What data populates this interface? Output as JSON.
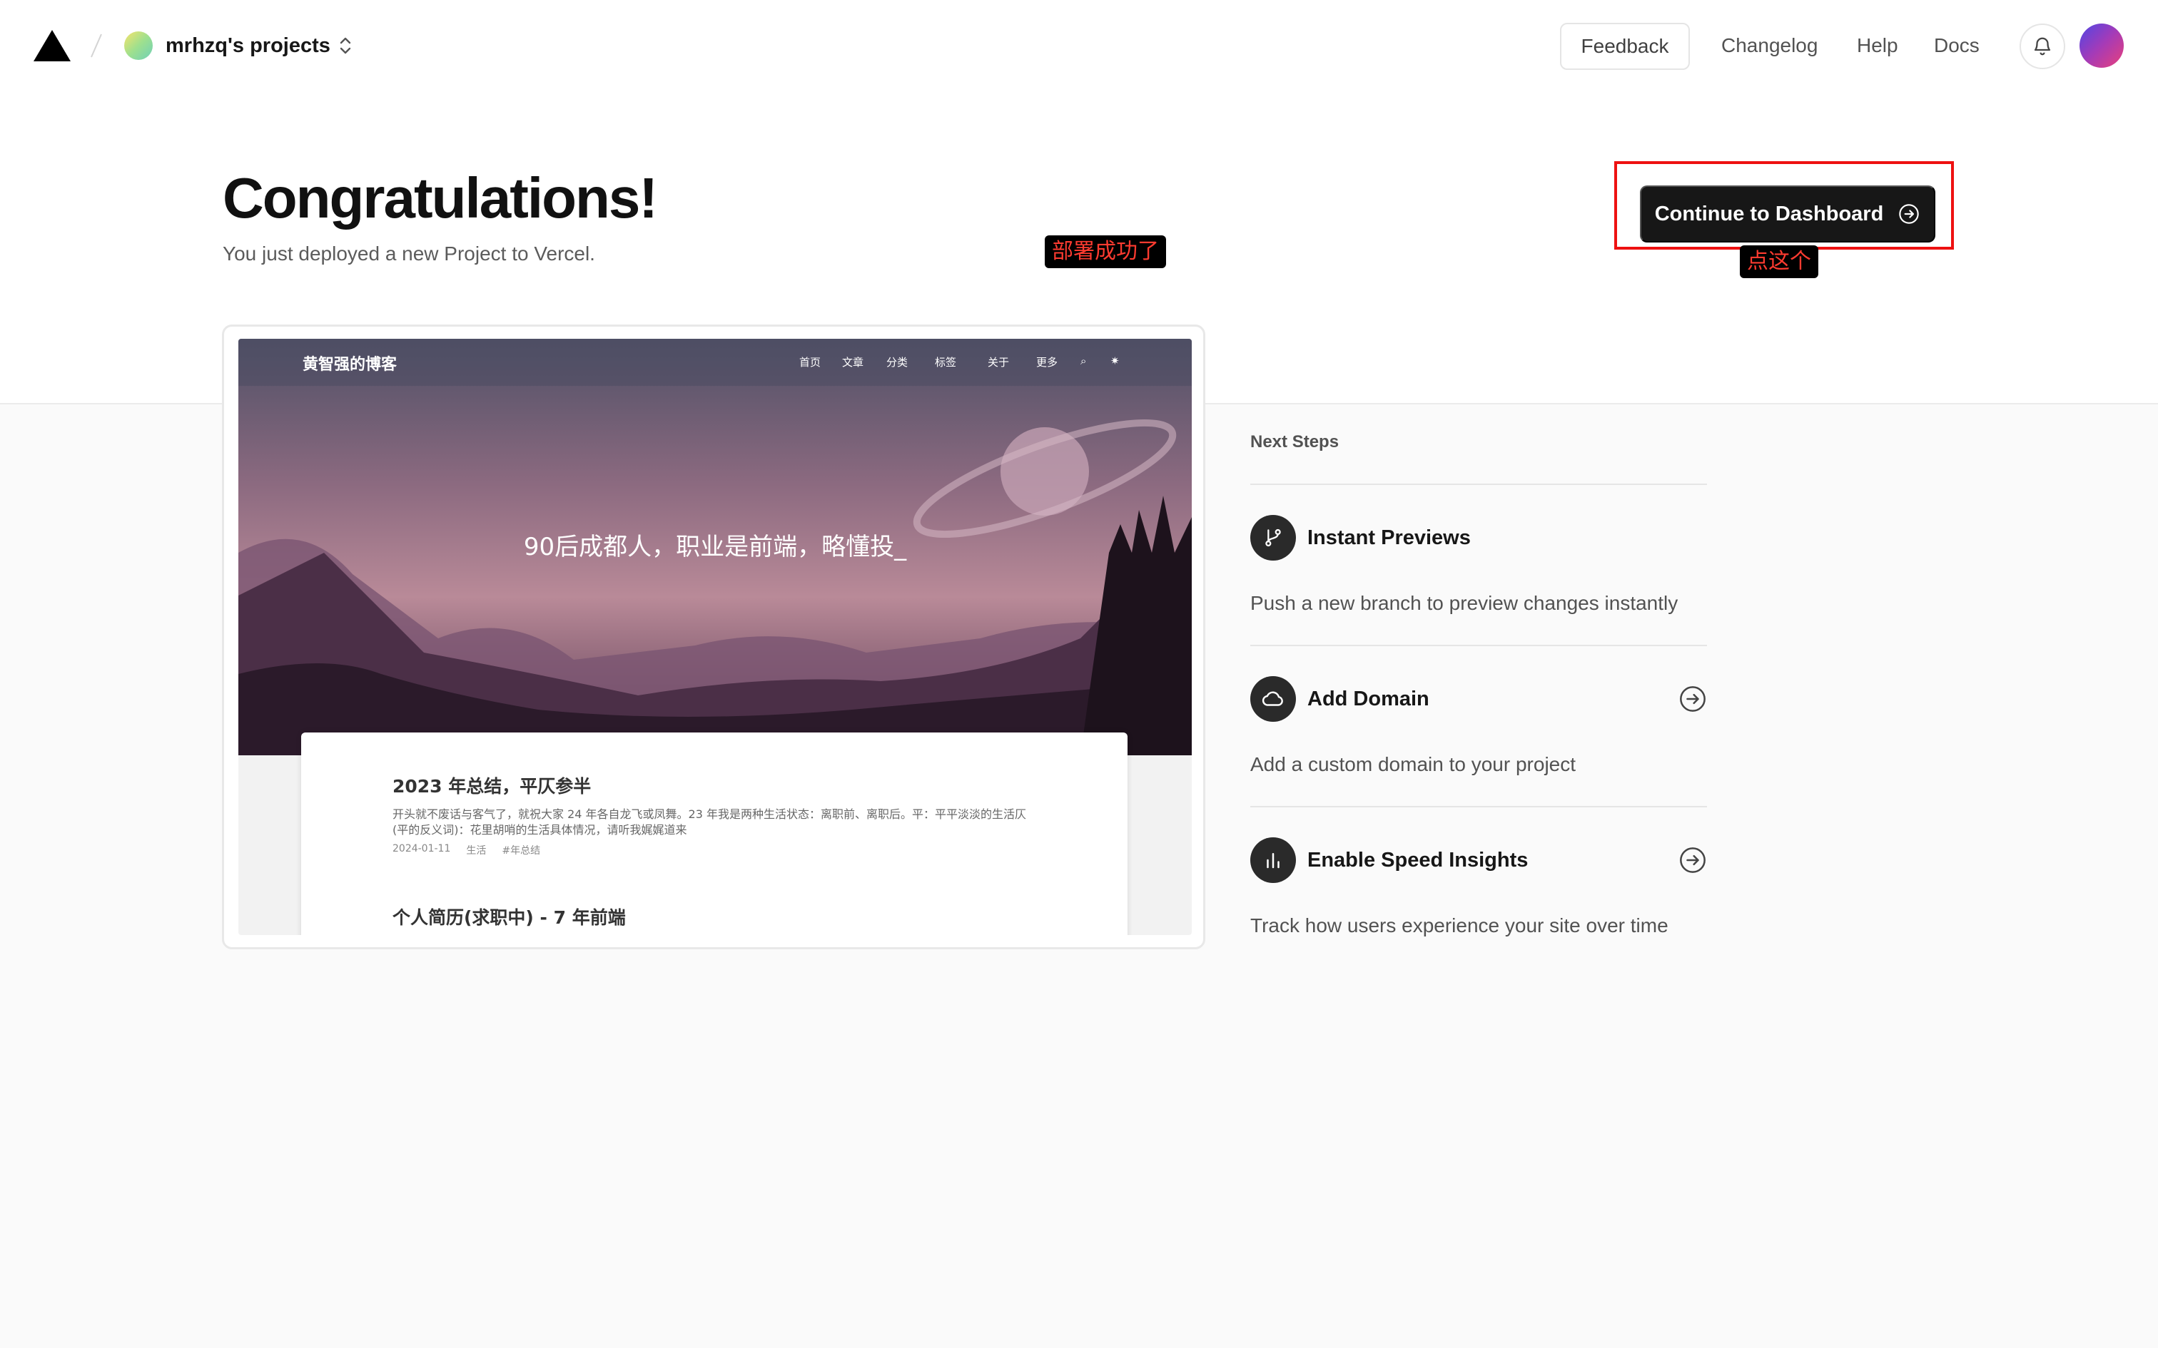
{
  "header": {
    "team_name": "mrhzq's projects",
    "feedback_label": "Feedback",
    "nav": [
      "Changelog",
      "Help",
      "Docs"
    ]
  },
  "hero": {
    "title": "Congratulations!",
    "subtitle": "You just deployed a new Project to Vercel.",
    "dashboard_button": "Continue to Dashboard"
  },
  "annotations": {
    "deploy_success": "部署成功了",
    "click_this": "点这个",
    "annotation_color": "#ff3b30",
    "box_color": "#ee1111"
  },
  "preview": {
    "blog_title": "黄智强的博客",
    "nav": [
      "首页",
      "文章",
      "分类",
      "标签",
      "关于",
      "更多"
    ],
    "slogan": "90后成都人，职业是前端，略懂投_",
    "posts": [
      {
        "title": "2023 年总结，平仄参半",
        "excerpt": "开头就不废话与客气了，就祝大家 24 年各自龙飞或凤舞。23 年我是两种生活状态：离职前、离职后。平：平平淡淡的生活仄(平的反义词)：花里胡哨的生活具体情况，请听我娓娓道来",
        "date": "2024-01-11",
        "category": "生活",
        "tag": "#年总结"
      },
      {
        "title": "个人简历(求职中) - 7 年前端"
      }
    ]
  },
  "next_steps": {
    "heading": "Next Steps",
    "items": [
      {
        "title": "Instant Previews",
        "desc": "Push a new branch to preview changes instantly",
        "icon": "git-branch-icon"
      },
      {
        "title": "Add Domain",
        "desc": "Add a custom domain to your project",
        "icon": "cloud-icon"
      },
      {
        "title": "Enable Speed Insights",
        "desc": "Track how users experience your site over time",
        "icon": "bar-chart-icon"
      }
    ]
  }
}
